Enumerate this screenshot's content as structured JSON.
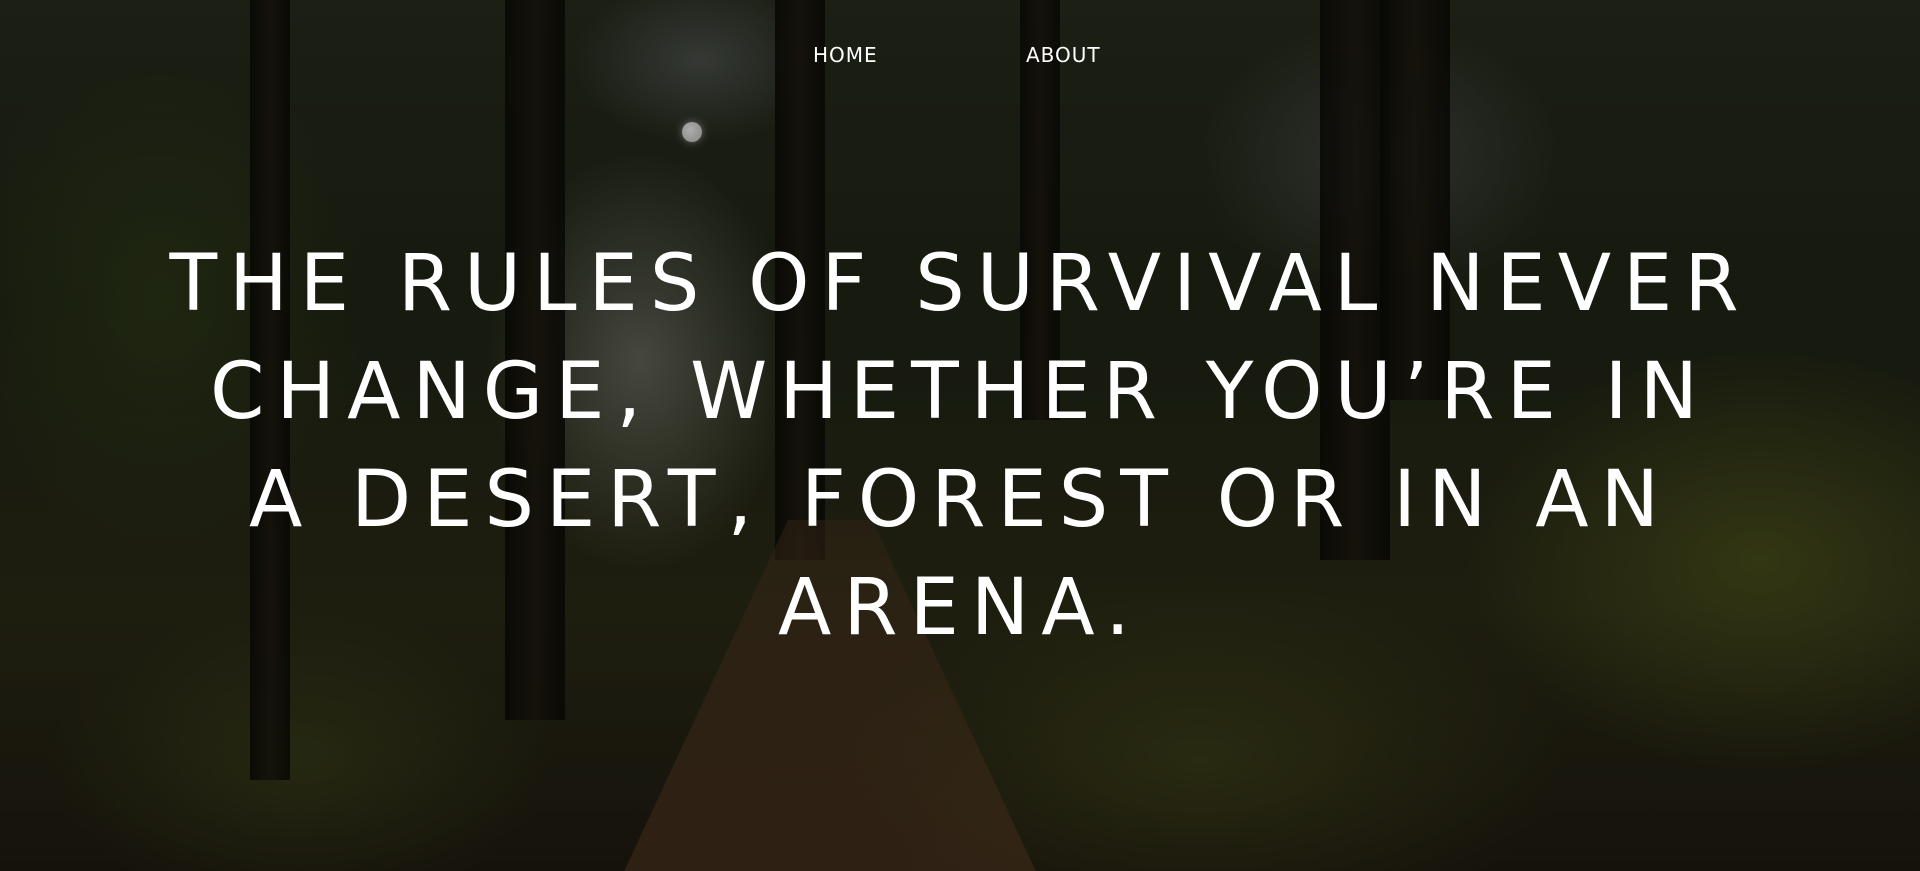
{
  "nav": {
    "home_label": "HOME",
    "about_label": "ABOUT"
  },
  "hero": {
    "headline": "THE RULES OF SURVIVAL NEVER CHANGE, WHETHER YOU’RE IN A DESERT, FOREST OR IN AN ARENA.",
    "background_image": "forest-path-photo"
  },
  "colors": {
    "text": "#ffffff",
    "background_dark": "#1f2415"
  }
}
